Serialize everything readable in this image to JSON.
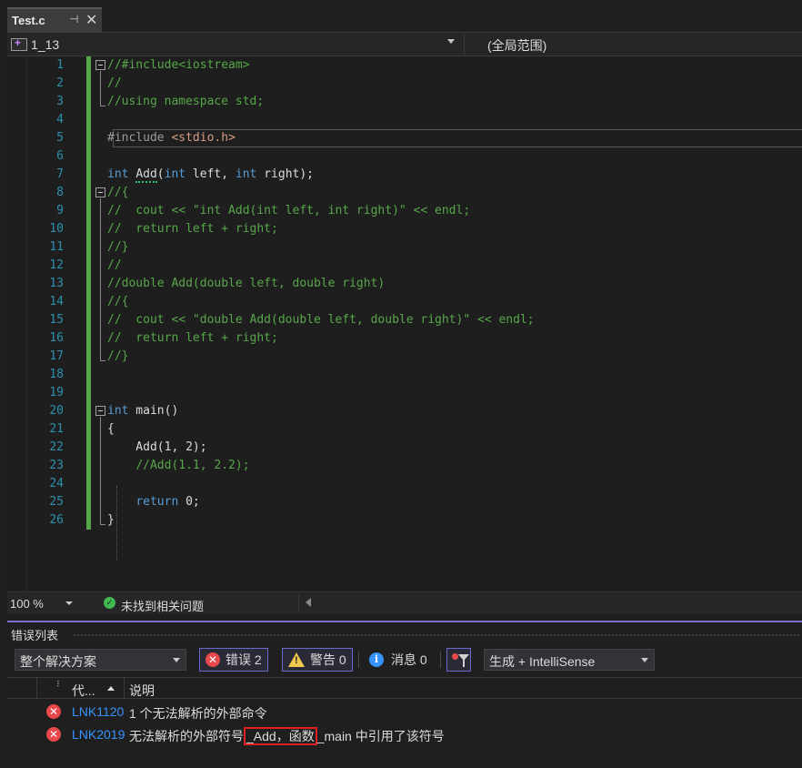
{
  "tab": {
    "title": "Test.c",
    "pin": "⊣",
    "close": "✕"
  },
  "navbar": {
    "project": "1_13",
    "scope": "(全局范围)"
  },
  "editor": {
    "line_numbers": [
      "1",
      "2",
      "3",
      "4",
      "5",
      "6",
      "7",
      "8",
      "9",
      "10",
      "11",
      "12",
      "13",
      "14",
      "15",
      "16",
      "17",
      "18",
      "19",
      "20",
      "21",
      "22",
      "23",
      "24",
      "25",
      "26"
    ],
    "lines": [
      "//#include<iostream>",
      "//",
      "//using namespace std;",
      "",
      "#include <stdio.h>",
      "",
      "int Add(int left, int right);",
      "//{",
      "//  cout << \"int Add(int left, int right)\" << endl;",
      "//  return left + right;",
      "//}",
      "//",
      "//double Add(double left, double right)",
      "//{",
      "//  cout << \"double Add(double left, double right)\" << endl;",
      "//  return left + right;",
      "//}",
      "",
      "",
      "int main()",
      "{",
      "    Add(1, 2);",
      "    //Add(1.1, 2.2);",
      "",
      "    return 0;",
      "}"
    ]
  },
  "status": {
    "zoom": "100 %",
    "issues": "未找到相关问题"
  },
  "error_list": {
    "title": "错误列表",
    "scope": "整个解决方案",
    "errors_label": "错误 2",
    "warnings_label": "警告 0",
    "messages_label": "消息 0",
    "build_source": "生成 + IntelliSense",
    "col_code": "代...",
    "col_desc": "说明",
    "rows": [
      {
        "code": "LNK1120",
        "desc": "1 个无法解析的外部命令",
        "desc_pre": "",
        "desc_hl": "",
        "desc_post": ""
      },
      {
        "code": "LNK2019",
        "desc": "",
        "desc_pre": "无法解析的外部符号",
        "desc_hl": "_Add，函数",
        "desc_post": "_main 中引用了该符号"
      }
    ]
  },
  "colors": {
    "comment": "#57a64a",
    "keyword": "#569cd6",
    "line_number": "#2b91af",
    "error": "#e8484a",
    "accent": "#7c6fd2"
  }
}
